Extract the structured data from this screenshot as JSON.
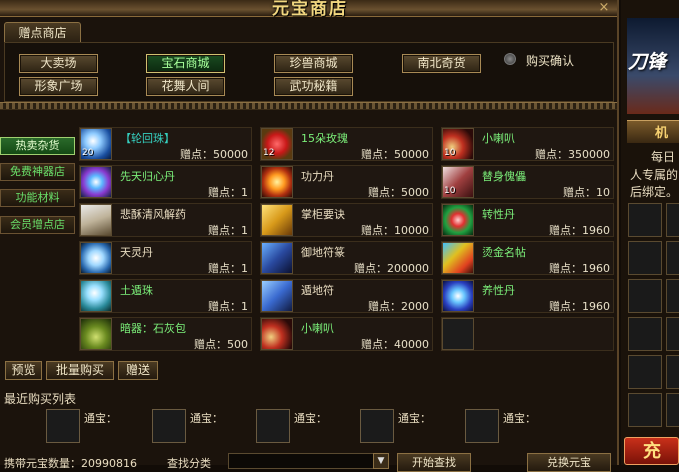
{
  "window": {
    "title": "元宝商店",
    "close_label": "×"
  },
  "tab": {
    "label": "赠点商店"
  },
  "categories": {
    "row1": [
      "大卖场",
      "宝石商城",
      "珍兽商城",
      "南北奇货"
    ],
    "row2": [
      "形象广场",
      "花舞人间",
      "武功秘籍"
    ],
    "active": "宝石商城"
  },
  "purchase_confirm_label": "购买确认",
  "side_menu": [
    "热卖杂货",
    "免费神器店",
    "功能材料",
    "会员增点店"
  ],
  "side_menu_active": "热卖杂货",
  "price_prefix": "赠点：",
  "items": [
    {
      "name": "【轮回珠】",
      "price": "50000",
      "qty": "20",
      "name_color": "#36d0c0",
      "icon": "blue-orb-icon"
    },
    {
      "name": "15朵玫瑰",
      "price": "50000",
      "qty": "12",
      "name_color": "#7cf07a",
      "icon": "rose-bouquet-icon"
    },
    {
      "name": "小喇叭",
      "price": "350000",
      "qty": "10",
      "name_color": "#7cf07a",
      "icon": "horn-icon"
    },
    {
      "name": "先天归心丹",
      "price": "1",
      "qty": "",
      "name_color": "#7cf07a",
      "icon": "swirl-orb-icon"
    },
    {
      "name": "功力丹",
      "price": "5000",
      "qty": "",
      "name_color": "#e8dcc0",
      "icon": "fire-pill-icon"
    },
    {
      "name": "替身傀儡",
      "price": "10",
      "qty": "10",
      "name_color": "#7cf07a",
      "icon": "puppet-icon"
    },
    {
      "name": "悲酥清风解药",
      "price": "1",
      "qty": "",
      "name_color": "#e8dcc0",
      "icon": "potion-bottle-icon"
    },
    {
      "name": "掌柜要诀",
      "price": "10000",
      "qty": "",
      "name_color": "#e8dcc0",
      "icon": "golden-book-icon"
    },
    {
      "name": "转性丹",
      "price": "1960",
      "qty": "",
      "name_color": "#7cf07a",
      "icon": "green-pill-icon"
    },
    {
      "name": "天灵丹",
      "price": "1",
      "qty": "",
      "name_color": "#e8dcc0",
      "icon": "spirit-swirl-icon"
    },
    {
      "name": "御地符篆",
      "price": "200000",
      "qty": "",
      "name_color": "#e8dcc0",
      "icon": "talisman-book-icon"
    },
    {
      "name": "烫金名帖",
      "price": "1960",
      "qty": "",
      "name_color": "#7cf07a",
      "icon": "gold-card-icon"
    },
    {
      "name": "土遁珠",
      "price": "1",
      "qty": "",
      "name_color": "#7cf07a",
      "icon": "crystal-ball-icon"
    },
    {
      "name": "遁地符",
      "price": "2000",
      "qty": "",
      "name_color": "#e8dcc0",
      "icon": "earth-talisman-icon"
    },
    {
      "name": "养性丹",
      "price": "1960",
      "qty": "",
      "name_color": "#7cf07a",
      "icon": "blue-crystal-icon"
    },
    {
      "name": "暗器：石灰包",
      "price": "500",
      "qty": "",
      "name_color": "#7cf07a",
      "icon": "lime-bag-icon"
    },
    {
      "name": "小喇叭",
      "price": "40000",
      "qty": "",
      "name_color": "#7cf07a",
      "icon": "horn-icon"
    },
    {
      "name": "",
      "price": "",
      "qty": "",
      "name_color": "#e8dcc0",
      "icon": "empty-slot"
    }
  ],
  "actions": {
    "preview": "预览",
    "bulk_buy": "批量购买",
    "gift": "赠送"
  },
  "recent": {
    "title": "最近购买列表",
    "slot_label": "通宝："
  },
  "footer": {
    "currency_label": "携带元宝数量：",
    "currency_value": "20990816",
    "search_label": "查找分类",
    "search_btn": "开始查找",
    "exchange_btn": "兑换元宝"
  },
  "right_panel": {
    "game_logo": "刀锋",
    "tag": "机",
    "text1": "每日",
    "text2": "人专属的",
    "text3": "后绑定。",
    "btn": "充"
  }
}
